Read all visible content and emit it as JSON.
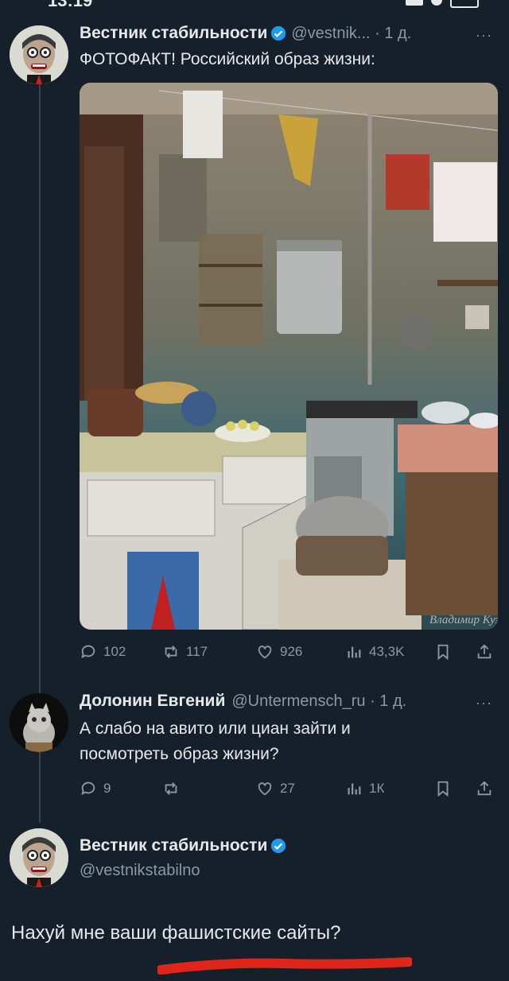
{
  "status": {
    "time": "13:19"
  },
  "tweet1": {
    "name": "Вестник стабильности",
    "handle_time": "@vestnik... · 1 д.",
    "text": "ФОТОФАКТ! Российский образ жизни:",
    "photo_signature": "Владимир Кузьмин",
    "stats": {
      "replies": "102",
      "retweets": "117",
      "likes": "926",
      "views": "43,3K"
    }
  },
  "tweet2": {
    "name": "Долонин Евгений",
    "handle_time": "@Untermensch_ru · 1 д.",
    "text_line1": "А слабо на авито или циан зайти и",
    "text_line2": "посмотреть образ жизни?",
    "stats": {
      "replies": "9",
      "retweets": "",
      "likes": "27",
      "views": "1К"
    }
  },
  "tweet3": {
    "name": "Вестник стабильности",
    "handle": "@vestnikstabilno",
    "text": "Нахуй мне ваши фашистские сайты?"
  },
  "icons": [
    "reply-icon",
    "retweet-icon",
    "like-icon",
    "views-icon",
    "bookmark-icon",
    "share-icon",
    "verified-icon"
  ],
  "colors": {
    "background": "#15202b",
    "text": "#e7e9ea",
    "muted": "#8b98a5",
    "verified": "#1d9bf0",
    "underline": "#e0261b"
  },
  "more_label": "···"
}
